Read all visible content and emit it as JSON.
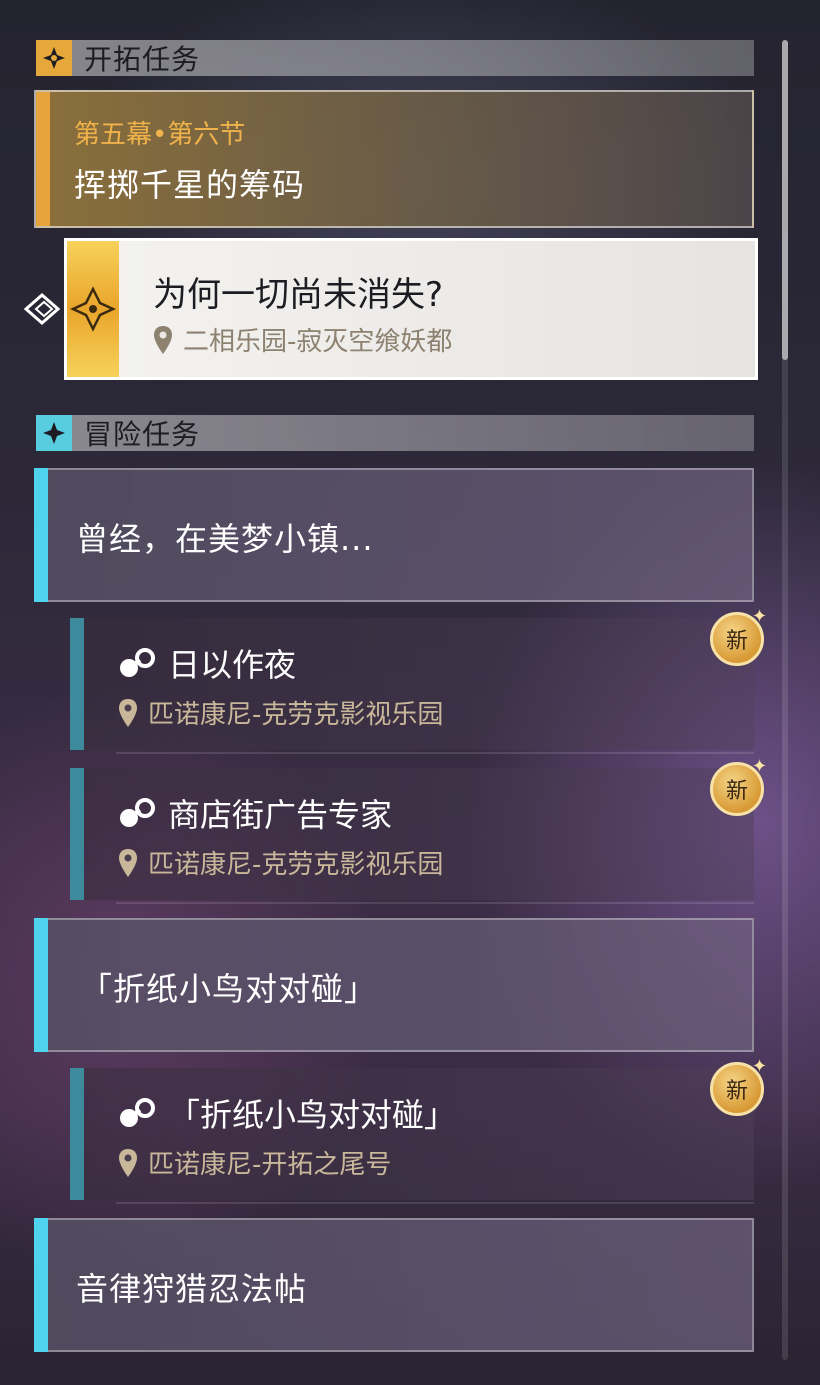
{
  "sections": {
    "trailblaze": {
      "title": "开拓任务",
      "icon": "trailblaze-icon"
    },
    "adventure": {
      "title": "冒险任务",
      "icon": "adventure-star-icon"
    }
  },
  "chapter": {
    "subtitle": "第五幕•第六节",
    "title": "挥掷千星的筹码"
  },
  "active_quest": {
    "title": "为何一切尚未消失?",
    "location": "二相乐园-寂灭空飨妖都",
    "tracker_icon": "tracking-arrow-icon"
  },
  "groups": [
    {
      "title": "曾经，在美梦小镇..."
    },
    {
      "title": "「折纸小鸟对对碰」"
    },
    {
      "title": "音律狩猎忍法帖"
    }
  ],
  "quests": [
    {
      "title": "日以作夜",
      "location": "匹诺康尼-克劳克影视乐园",
      "badge": "新"
    },
    {
      "title": "商店街广告专家",
      "location": "匹诺康尼-克劳克影视乐园",
      "badge": "新"
    },
    {
      "title": "「折纸小鸟对对碰」",
      "location": "匹诺康尼-开拓之尾号",
      "badge": "新"
    }
  ],
  "colors": {
    "trailblaze_accent": "#e6a83a",
    "adventure_accent": "#59cde0",
    "quest_bar": "#3d8a9c"
  }
}
